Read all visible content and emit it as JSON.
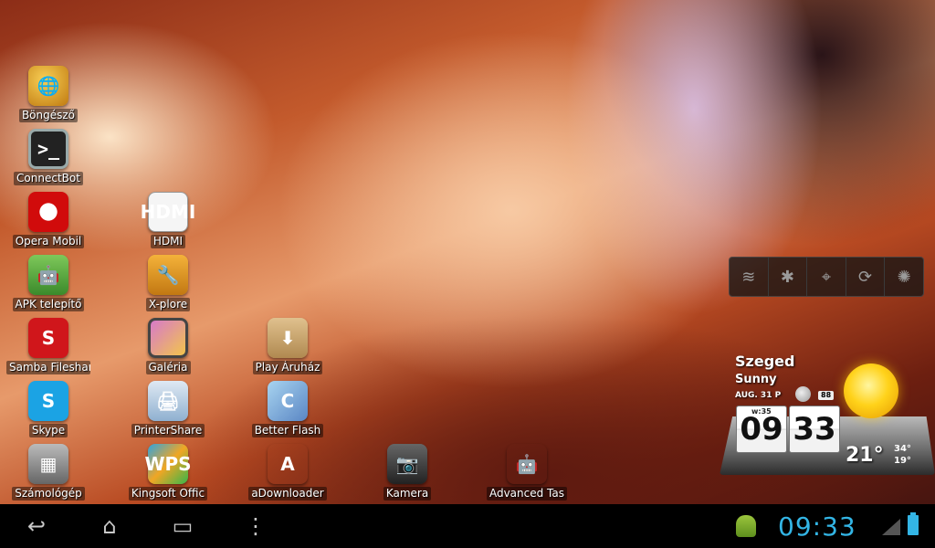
{
  "apps": [
    {
      "id": "browser",
      "label": "Böngésző",
      "glyph": "🌐"
    },
    {
      "id": "connectbot",
      "label": "ConnectBot",
      "glyph": ">_"
    },
    {
      "id": "opera",
      "label": "Opera Mobil",
      "glyph": ""
    },
    {
      "id": "hdmi",
      "label": "HDMI",
      "glyph": "HDMI"
    },
    {
      "id": "apk",
      "label": "APK telepítő",
      "glyph": "🤖"
    },
    {
      "id": "xplore",
      "label": "X-plore",
      "glyph": "🔧"
    },
    {
      "id": "samba",
      "label": "Samba Fileshar",
      "glyph": "S"
    },
    {
      "id": "galeria",
      "label": "Galéria",
      "glyph": ""
    },
    {
      "id": "play",
      "label": "Play Áruház",
      "glyph": "⬇"
    },
    {
      "id": "skype",
      "label": "Skype",
      "glyph": "S"
    },
    {
      "id": "printershare",
      "label": "PrinterShare",
      "glyph": "🖨"
    },
    {
      "id": "betterflash",
      "label": "Better Flash",
      "glyph": "C"
    },
    {
      "id": "calculator",
      "label": "Számológép",
      "glyph": "▦"
    },
    {
      "id": "kingsoft",
      "label": "Kingsoft Offic",
      "glyph": "WPS"
    },
    {
      "id": "adownloader",
      "label": "aDownloader",
      "glyph": "A"
    },
    {
      "id": "camera",
      "label": "Kamera",
      "glyph": "📷"
    },
    {
      "id": "advanced",
      "label": "Advanced Tas",
      "glyph": "🤖"
    }
  ],
  "power_widget": {
    "icons": [
      "wifi-icon",
      "bluetooth-icon",
      "gps-icon",
      "sync-icon",
      "brightness-icon"
    ],
    "glyphs": [
      "≋",
      "✱",
      "⌖",
      "⟳",
      "✺"
    ]
  },
  "weather": {
    "city": "Szeged",
    "condition": "Sunny",
    "date": "AUG. 31 P",
    "badge": "88",
    "week": "w:35",
    "hour": "09",
    "minute": "33",
    "temp": "21°",
    "high": "34°",
    "low": "19°"
  },
  "systembar": {
    "clock": "09:33",
    "back_glyph": "↩",
    "home_glyph": "⌂",
    "recent_glyph": "▭",
    "menu_glyph": "⋮"
  },
  "colors": {
    "accent": "#33b5e5",
    "systembar_bg": "#000000"
  }
}
